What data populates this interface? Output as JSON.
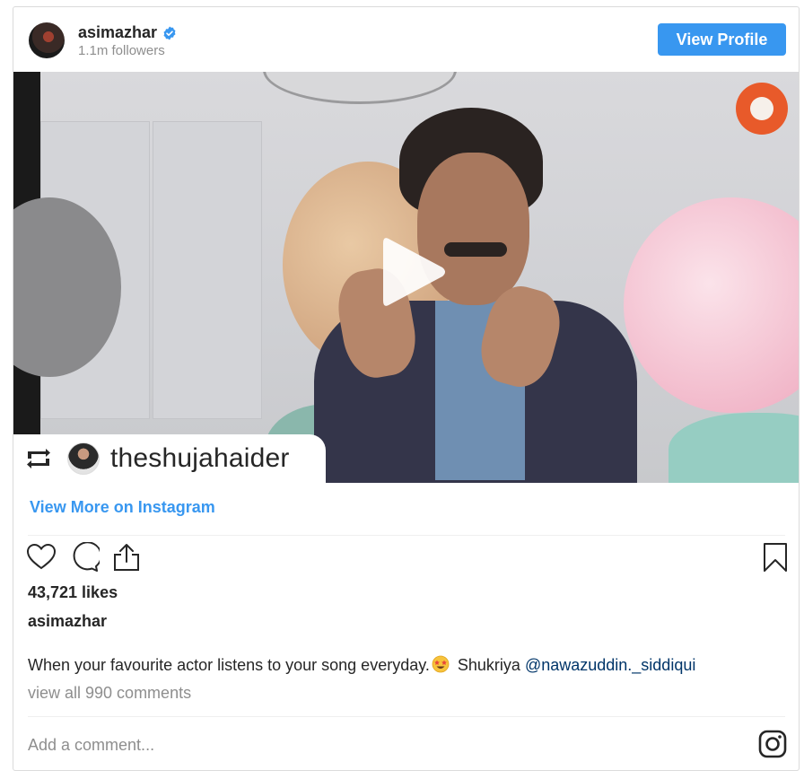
{
  "post": {
    "author": {
      "username": "asimazhar",
      "verified": true,
      "followers": "1.1m followers"
    },
    "header": {
      "view_profile_label": "View Profile"
    },
    "media": {
      "type": "video",
      "regram_username": "theshujahaider"
    },
    "view_more_label": "View More on Instagram",
    "likes": "43,721 likes",
    "caption": {
      "username": "asimazhar",
      "text": "When your favourite actor listens to your song everyday.",
      "after_emoji": " Shukriya ",
      "mention": "@nawazuddin._siddiqui"
    },
    "view_comments_label": "view all 990 comments",
    "comment_placeholder": "Add a comment..."
  },
  "icons": {
    "verified": "verified-badge-icon",
    "play": "play-icon",
    "regram": "regram-icon",
    "like": "heart-icon",
    "comment": "comment-icon",
    "share": "share-icon",
    "save": "bookmark-icon",
    "instagram": "instagram-icon",
    "emoji": "star-struck-emoji-icon"
  },
  "colors": {
    "accent": "#3897f0",
    "mention": "#003569",
    "muted": "#8e8e8e",
    "text": "#262626"
  }
}
